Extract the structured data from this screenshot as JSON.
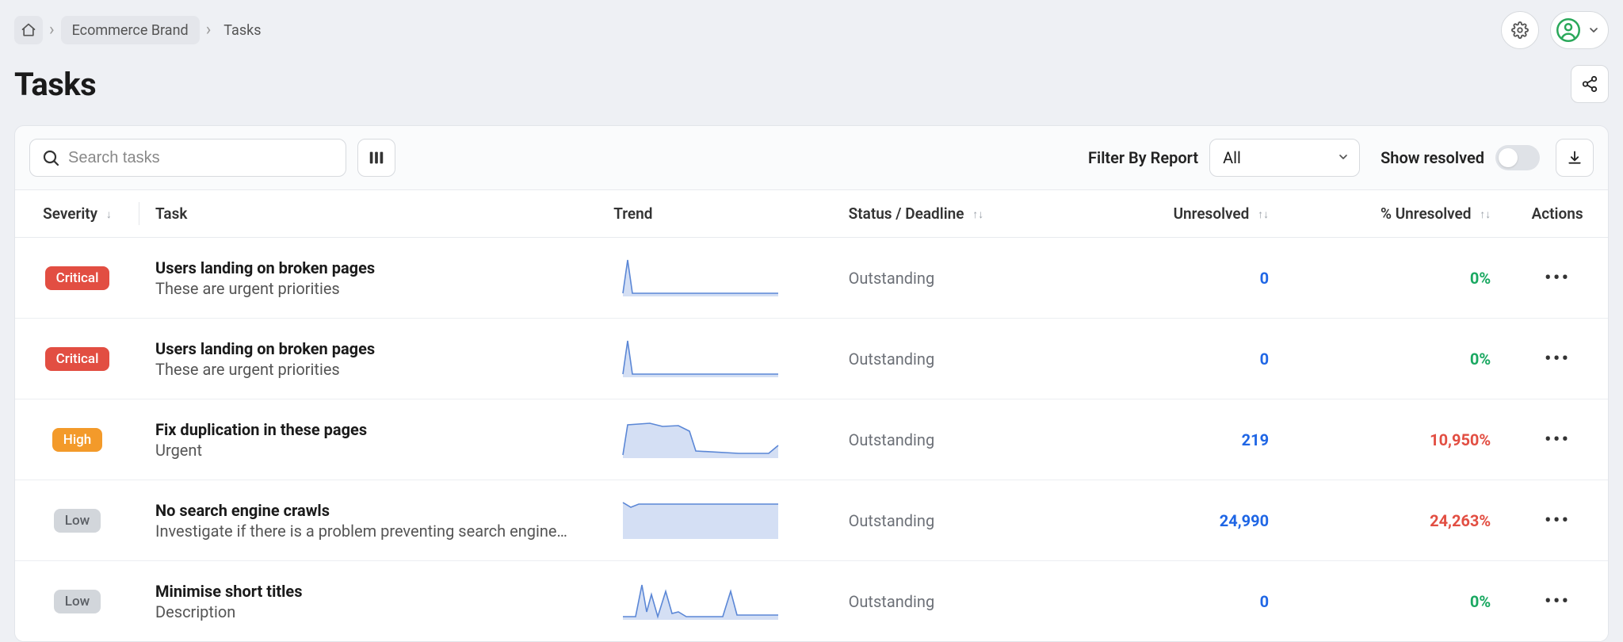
{
  "breadcrumbs": {
    "brand": "Ecommerce Brand",
    "leaf": "Tasks"
  },
  "page_title": "Tasks",
  "toolbar": {
    "search_placeholder": "Search tasks",
    "filter_label": "Filter By Report",
    "filter_selected": "All",
    "show_resolved_label": "Show resolved"
  },
  "columns": {
    "severity": "Severity",
    "task": "Task",
    "trend": "Trend",
    "status": "Status / Deadline",
    "unresolved": "Unresolved",
    "pct_unresolved": "% Unresolved",
    "actions": "Actions"
  },
  "rows": [
    {
      "severity": "Critical",
      "title": "Users landing on broken pages",
      "desc": "These are urgent priorities",
      "status": "Outstanding",
      "unresolved": "0",
      "unresolved_class": "link",
      "pct": "0%",
      "pct_class": "good",
      "spark": "spike"
    },
    {
      "severity": "Critical",
      "title": "Users landing on broken pages",
      "desc": "These are urgent priorities",
      "status": "Outstanding",
      "unresolved": "0",
      "unresolved_class": "link",
      "pct": "0%",
      "pct_class": "good",
      "spark": "spike"
    },
    {
      "severity": "High",
      "title": "Fix duplication in these pages",
      "desc": "Urgent",
      "status": "Outstanding",
      "unresolved": "219",
      "unresolved_class": "link",
      "pct": "10,950%",
      "pct_class": "bad",
      "spark": "plateau"
    },
    {
      "severity": "Low",
      "title": "No search engine crawls",
      "desc": "Investigate if there is a problem preventing search engines...",
      "status": "Outstanding",
      "unresolved": "24,990",
      "unresolved_class": "link",
      "pct": "24,263%",
      "pct_class": "bad",
      "spark": "flat"
    },
    {
      "severity": "Low",
      "title": "Minimise short titles",
      "desc": "Description",
      "status": "Outstanding",
      "unresolved": "0",
      "unresolved_class": "link",
      "pct": "0%",
      "pct_class": "good",
      "spark": "jagged"
    }
  ]
}
